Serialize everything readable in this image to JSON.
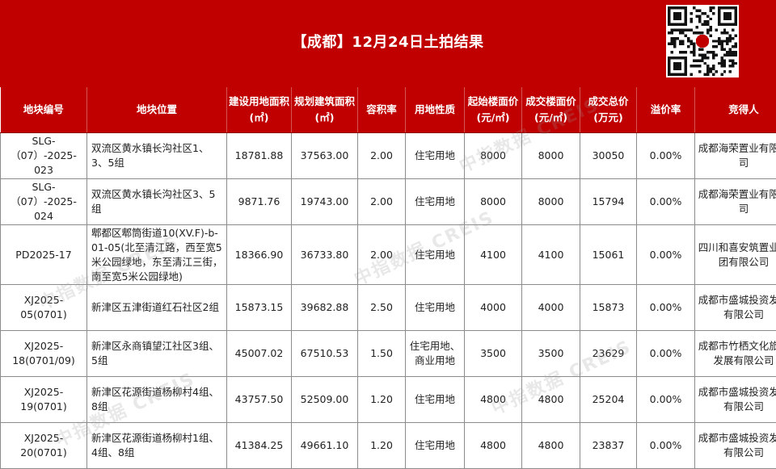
{
  "header": {
    "title": "【成都】12月24日土拍结果",
    "qr_icon": "qr-code-icon",
    "accent_color": "#c00000"
  },
  "watermark": "中指数据 CREIS",
  "table": {
    "columns": [
      "地块编号",
      "地块位置",
      "建设用地面积(㎡)",
      "规划建筑面积(㎡)",
      "容积率",
      "用地性质",
      "起始楼面价(元/㎡)",
      "成交楼面价(元/㎡)",
      "成交总价(万元)",
      "溢价率",
      "竞得人"
    ],
    "rows": [
      [
        "SLG-（07）-2025-023",
        "双流区黄水镇长沟社区1、3、5组",
        "18781.88",
        "37563.00",
        "2.00",
        "住宅用地",
        "8000",
        "8000",
        "30050",
        "0.00%",
        "成都海荣置业有限公司"
      ],
      [
        "SLG-（07）-2025-024",
        "双流区黄水镇长沟社区3、5组",
        "9871.76",
        "19743.00",
        "2.00",
        "住宅用地",
        "8000",
        "8000",
        "15794",
        "0.00%",
        "成都海荣置业有限公司"
      ],
      [
        "PD2025-17",
        "郫都区郫筒街道10(XV.F)-b-01-05(北至清江路，西至宽5米公园绿地，东至清江三街，南至宽5米公园绿地)",
        "18366.90",
        "36733.80",
        "2.00",
        "住宅用地",
        "4100",
        "4100",
        "15061",
        "0.00%",
        "四川和喜安筑置业集团有限公司"
      ],
      [
        "XJ2025-05(0701)",
        "新津区五津街道红石社区2组",
        "15873.15",
        "39682.88",
        "2.50",
        "住宅用地",
        "4000",
        "4000",
        "15873",
        "0.00%",
        "成都市盛城投资发展有限公司"
      ],
      [
        "XJ2025-18(0701/09)",
        "新津区永商镇望江社区3组、5组",
        "45007.02",
        "67510.53",
        "1.50",
        "住宅用地、商业用地",
        "3500",
        "3500",
        "23629",
        "0.00%",
        "成都市竹栖文化旅游发展有限公司"
      ],
      [
        "XJ2025-19(0701)",
        "新津区花源街道杨柳村4组、8组",
        "43757.50",
        "52509.00",
        "1.20",
        "住宅用地",
        "4800",
        "4800",
        "25204",
        "0.00%",
        "成都市盛城投资发展有限公司"
      ],
      [
        "XJ2025-20(0701)",
        "新津区花源街道杨柳村1组、4组、8组",
        "41384.25",
        "49661.10",
        "1.20",
        "住宅用地",
        "4800",
        "4800",
        "23837",
        "0.00%",
        "成都市盛城投资发展有限公司"
      ]
    ]
  }
}
